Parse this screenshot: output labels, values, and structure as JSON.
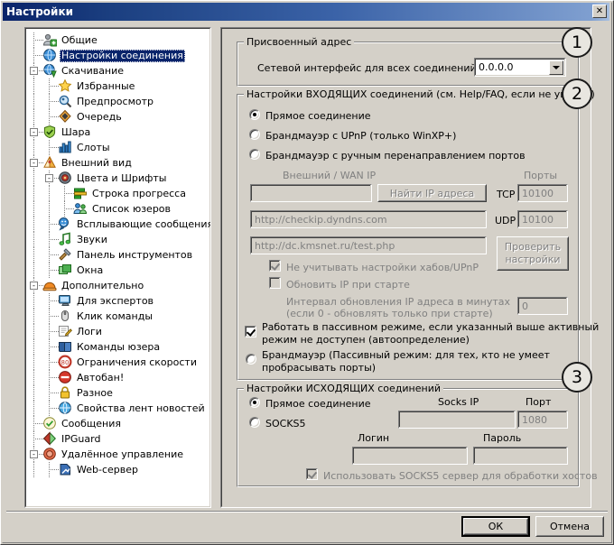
{
  "window": {
    "title": "Настройки",
    "close_label": "✕"
  },
  "tree": {
    "items": [
      {
        "label": "Общие",
        "icon": "users-add-icon",
        "depth": 1,
        "selected": false,
        "expander": ""
      },
      {
        "label": "Настройки соединения",
        "icon": "globe-blue-icon",
        "depth": 1,
        "selected": true,
        "expander": ""
      },
      {
        "label": "Скачивание",
        "icon": "globe-download-icon",
        "depth": 1,
        "selected": false,
        "expander": "-"
      },
      {
        "label": "Избранные",
        "icon": "star-icon",
        "depth": 2,
        "selected": false,
        "expander": ""
      },
      {
        "label": "Предпросмотр",
        "icon": "preview-icon",
        "depth": 2,
        "selected": false,
        "expander": ""
      },
      {
        "label": "Очередь",
        "icon": "queue-icon",
        "depth": 2,
        "selected": false,
        "expander": ""
      },
      {
        "label": "Шара",
        "icon": "share-shield-icon",
        "depth": 1,
        "selected": false,
        "expander": "-"
      },
      {
        "label": "Слоты",
        "icon": "bars-icon",
        "depth": 2,
        "selected": false,
        "expander": ""
      },
      {
        "label": "Внешний вид",
        "icon": "appearance-icon",
        "depth": 1,
        "selected": false,
        "expander": "-"
      },
      {
        "label": "Цвета и Шрифты",
        "icon": "palette-icon",
        "depth": 2,
        "selected": false,
        "expander": "-"
      },
      {
        "label": "Строка прогресса",
        "icon": "progressbar-icon",
        "depth": 3,
        "selected": false,
        "expander": ""
      },
      {
        "label": "Список юзеров",
        "icon": "users-icon",
        "depth": 3,
        "selected": false,
        "expander": ""
      },
      {
        "label": "Всплывающие сообщения",
        "icon": "popup-message-icon",
        "depth": 2,
        "selected": false,
        "expander": ""
      },
      {
        "label": "Звуки",
        "icon": "sound-note-icon",
        "depth": 2,
        "selected": false,
        "expander": ""
      },
      {
        "label": "Панель инструментов",
        "icon": "toolbar-hammer-icon",
        "depth": 2,
        "selected": false,
        "expander": ""
      },
      {
        "label": "Окна",
        "icon": "windows-icon",
        "depth": 2,
        "selected": false,
        "expander": ""
      },
      {
        "label": "Дополнительно",
        "icon": "helmet-icon",
        "depth": 1,
        "selected": false,
        "expander": "-"
      },
      {
        "label": "Для экспертов",
        "icon": "monitor-icon",
        "depth": 2,
        "selected": false,
        "expander": ""
      },
      {
        "label": "Клик команды",
        "icon": "mouse-icon",
        "depth": 2,
        "selected": false,
        "expander": ""
      },
      {
        "label": "Логи",
        "icon": "log-pencil-icon",
        "depth": 2,
        "selected": false,
        "expander": ""
      },
      {
        "label": "Команды юзера",
        "icon": "book-icon",
        "depth": 2,
        "selected": false,
        "expander": ""
      },
      {
        "label": "Ограничения скорости",
        "icon": "speed-limit-icon",
        "depth": 2,
        "selected": false,
        "expander": ""
      },
      {
        "label": "Автобан!",
        "icon": "autoban-icon",
        "depth": 2,
        "selected": false,
        "expander": ""
      },
      {
        "label": "Разное",
        "icon": "lock-icon",
        "depth": 2,
        "selected": false,
        "expander": ""
      },
      {
        "label": "Свойства лент новостей",
        "icon": "rss-globe-icon",
        "depth": 2,
        "selected": false,
        "expander": ""
      },
      {
        "label": "Сообщения",
        "icon": "check-message-icon",
        "depth": 1,
        "selected": false,
        "expander": ""
      },
      {
        "label": "IPGuard",
        "icon": "ipguard-icon",
        "depth": 1,
        "selected": false,
        "expander": ""
      },
      {
        "label": "Удалённое управление",
        "icon": "remote-icon",
        "depth": 1,
        "selected": false,
        "expander": "-"
      },
      {
        "label": "Web-сервер",
        "icon": "webserver-icon",
        "depth": 2,
        "selected": false,
        "expander": ""
      }
    ]
  },
  "badges": {
    "one": "1",
    "two": "2",
    "three": "3"
  },
  "group_assigned_address": {
    "title": "Присвоенный адрес",
    "interface_label": "Сетевой интерфейс для всех соединений",
    "interface_value": "0.0.0.0"
  },
  "group_incoming": {
    "title": "Настройки ВХОДЯЩИХ соединений (см. Help/FAQ, если не уверен)",
    "radio_direct": "Прямое соединение",
    "radio_upnp": "Брандмауэр с UPnP (только WinXP+)",
    "radio_manual": "Брандмауэр с ручным перенаправлением портов",
    "wan_ip_label": "Внешний / WAN IP",
    "wan_ip_value": "",
    "find_ip_button": "Найти IP адреса",
    "ports_label": "Порты",
    "tcp_label": "TCP",
    "tcp_value": "10100",
    "udp_label": "UDP",
    "udp_value": "10100",
    "checkip_url": "http://checkip.dyndns.com",
    "test_url": "http://dc.kmsnet.ru/test.php",
    "check_settings_line1": "Проверить",
    "check_settings_line2": "настройки",
    "ignore_hubs_label": "Не учитывать настройки хабов/UPnP",
    "update_ip_label": "Обновить IP при старте",
    "interval_line1": "Интервал обновления IP адреса в минутах",
    "interval_line2": "(если 0 - обновлять только при старте)",
    "interval_value": "0",
    "passive_line1": "Работать в пассивном режиме, если указанный выше активный",
    "passive_line2": "режим не доступен (автоопределение)",
    "firewall_passive_line1": "Брандмауэр (Пассивный режим: для тех, кто не умеет",
    "firewall_passive_line2": "пробрасывать порты)"
  },
  "group_outgoing": {
    "title": "Настройки ИСХОДЯЩИХ соединений",
    "radio_direct": "Прямое соединение",
    "radio_socks5": "SOCKS5",
    "socks_ip_label": "Socks IP",
    "socks_ip_value": "",
    "port_label": "Порт",
    "port_value": "1080",
    "login_label": "Логин",
    "login_value": "",
    "password_label": "Пароль",
    "password_value": "",
    "use_socks_hosts_label": "Использовать SOCKS5 сервер для обработки хостов"
  },
  "footer": {
    "ok": "ОК",
    "cancel": "Отмена"
  },
  "colors": {
    "face": "#d4d0c8",
    "title_start": "#0a246a",
    "title_end": "#a8c0e0",
    "selection": "#08246b",
    "disabled_text": "#808080"
  }
}
